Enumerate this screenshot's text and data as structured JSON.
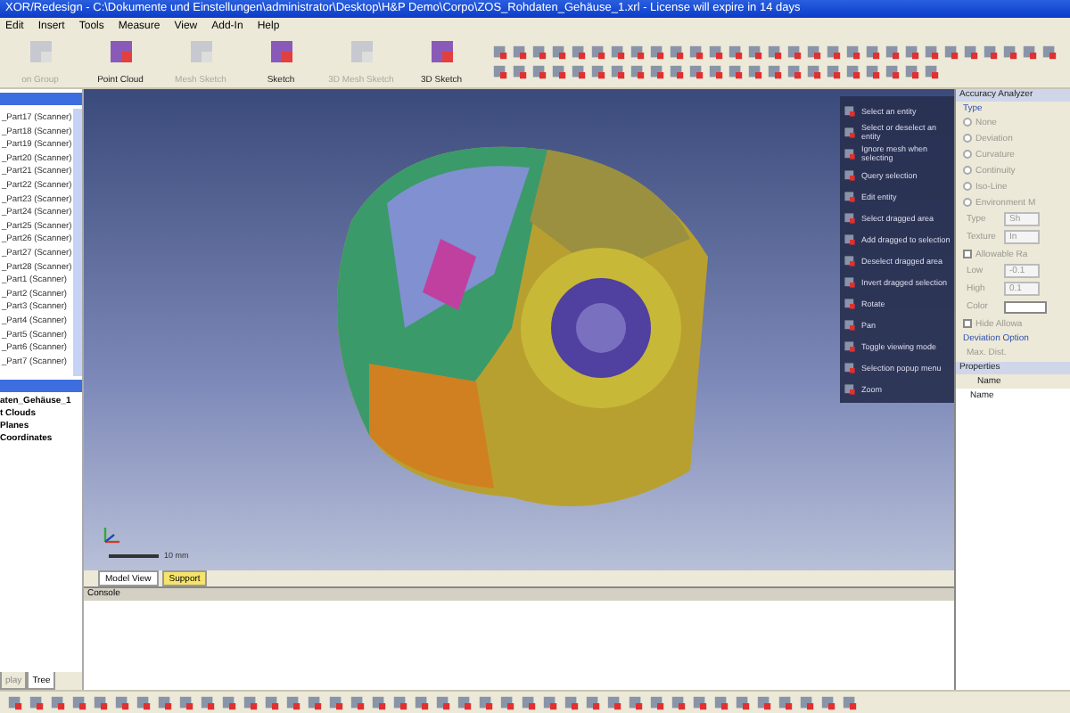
{
  "window": {
    "title": "XOR/Redesign - C:\\Dokumente und Einstellungen\\administrator\\Desktop\\H&P Demo\\Corpo\\ZOS_Rohdaten_Gehäuse_1.xrl - License will expire in 14 days"
  },
  "menu": [
    "Edit",
    "Insert",
    "Tools",
    "Measure",
    "View",
    "Add-In",
    "Help"
  ],
  "toolbar": {
    "buttons": [
      {
        "label": "on Group",
        "disabled": true
      },
      {
        "label": "Point Cloud",
        "disabled": false
      },
      {
        "label": "Mesh Sketch",
        "disabled": true
      },
      {
        "label": "Sketch",
        "disabled": false
      },
      {
        "label": "3D Mesh Sketch",
        "disabled": true
      },
      {
        "label": "3D Sketch",
        "disabled": false
      }
    ]
  },
  "scan_list": {
    "items": [
      "_Part17 (Scanner)",
      "_Part18 (Scanner)",
      "_Part19 (Scanner)",
      "_Part20 (Scanner)",
      "_Part21 (Scanner)",
      "_Part22 (Scanner)",
      "_Part23 (Scanner)",
      "_Part24 (Scanner)",
      "_Part25 (Scanner)",
      "_Part26 (Scanner)",
      "_Part27 (Scanner)",
      "_Part28 (Scanner)",
      "_Part1 (Scanner)",
      "_Part2 (Scanner)",
      "_Part3 (Scanner)",
      "_Part4 (Scanner)",
      "_Part5 (Scanner)",
      "_Part6 (Scanner)",
      "_Part7 (Scanner)"
    ]
  },
  "tree": {
    "items": [
      {
        "label": "aten_Gehäuse_1",
        "children": [
          {
            "label": "t Clouds"
          },
          {
            "label": "Planes"
          },
          {
            "label": "Coordinates"
          }
        ]
      }
    ]
  },
  "left_tabs": [
    {
      "label": "play",
      "selected": false
    },
    {
      "label": "Tree",
      "selected": true
    }
  ],
  "viewport": {
    "scale_label": "10 mm"
  },
  "context_menu": [
    "Select an entity",
    "Select or deselect an entity",
    "Ignore mesh when selecting",
    "Query selection",
    "Edit entity",
    "Select dragged area",
    "Add dragged to selection",
    "Deselect dragged area",
    "Invert dragged selection",
    "Rotate",
    "Pan",
    "Toggle viewing mode",
    "Selection popup menu",
    "Zoom"
  ],
  "view_tabs": [
    {
      "label": "Model View",
      "selected": false
    },
    {
      "label": "Support",
      "selected": true
    }
  ],
  "console": {
    "title": "Console"
  },
  "accuracy": {
    "title": "Accuracy Analyzer",
    "group": "Type",
    "options": [
      {
        "label": "None",
        "selected": false
      },
      {
        "label": "Deviation",
        "selected": false
      },
      {
        "label": "Curvature",
        "selected": false
      },
      {
        "label": "Continuity",
        "selected": false
      },
      {
        "label": "Iso-Line",
        "selected": false
      },
      {
        "label": "Environment M",
        "selected": false
      }
    ],
    "fields": [
      {
        "label": "Type",
        "value": "Sh"
      },
      {
        "label": "Texture",
        "value": "In"
      }
    ],
    "allowable": {
      "label": "Allowable Ra",
      "checked": false
    },
    "ranges": [
      {
        "label": "Low",
        "value": "-0.1"
      },
      {
        "label": "High",
        "value": "0.1"
      }
    ],
    "color_label": "Color",
    "hide": {
      "label": "Hide Allowa",
      "checked": false
    },
    "deviation_title": "Deviation Option",
    "max_dist": "Max. Dist."
  },
  "properties": {
    "title": "Properties",
    "column": "Name",
    "row": "Name"
  }
}
